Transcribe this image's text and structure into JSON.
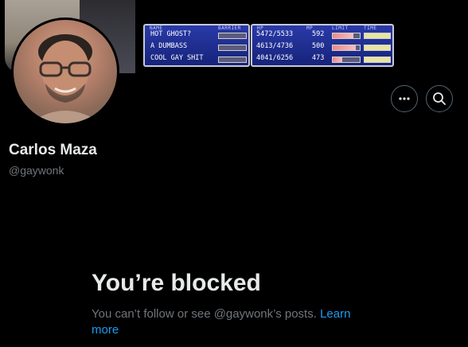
{
  "banner": {
    "ff_panel": {
      "headers": [
        "NAME",
        "BARRIER",
        "HP",
        "MP",
        "LIMIT",
        "TIME"
      ],
      "rows": [
        {
          "name": "HOT GHOST?",
          "hp": "5472/5533",
          "mp": "592",
          "limit": 0.75
        },
        {
          "name": "A DUMBASS",
          "hp": "4613/4736",
          "mp": "500",
          "limit": 0.85
        },
        {
          "name": "COOL GAY SHIT",
          "hp": "4041/6256",
          "mp": "473",
          "limit": 0.35
        }
      ]
    }
  },
  "profile": {
    "display_name": "Carlos Maza",
    "handle": "@gaywonk"
  },
  "actions": {
    "more_icon": "more-horizontal-icon",
    "search_icon": "search-icon"
  },
  "blocked": {
    "title": "You’re blocked",
    "message": "You can’t follow or see @gaywonk’s posts.",
    "link": "Learn more"
  },
  "colors": {
    "accent": "#1d9bf0",
    "text_primary": "#e7e9ea",
    "text_secondary": "#71767b",
    "background": "#000000",
    "border": "#536471"
  }
}
